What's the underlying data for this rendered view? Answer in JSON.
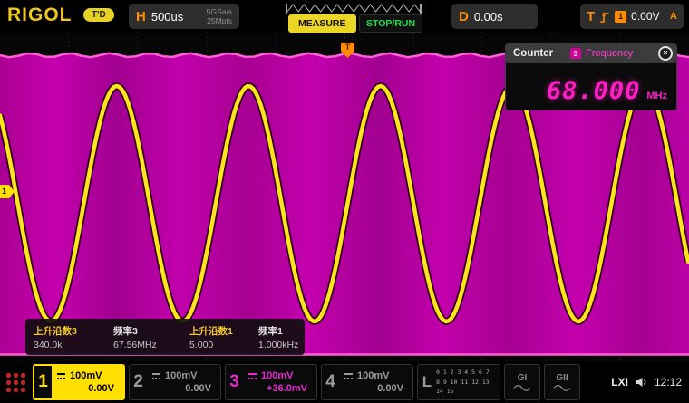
{
  "topbar": {
    "logo": "RIGOL",
    "trig_status": "T'D",
    "horizontal": {
      "label": "H",
      "timebase": "500us",
      "sample_rate": "5GSa/s",
      "memory_depth": "25Mpts"
    },
    "measure_button": "MEASURE",
    "run_button": "STOP/RUN",
    "delay": {
      "label": "D",
      "value": "0.00s"
    },
    "trigger": {
      "label": "T",
      "source": "1",
      "level": "0.00V",
      "mode": "A"
    }
  },
  "markers": {
    "trigger": "T",
    "channel1": "1"
  },
  "counter": {
    "title": "Counter",
    "source": "3",
    "mode": "Frequency",
    "value": "68.000",
    "unit": "MHz",
    "close": "✕"
  },
  "measurements": {
    "items": [
      {
        "label": "上升沿数3",
        "value": "340.0k"
      },
      {
        "label": "频率3",
        "value": "67.56MHz"
      },
      {
        "label": "上升沿数1",
        "value": "5.000"
      },
      {
        "label": "频率1",
        "value": "1.000kHz"
      }
    ]
  },
  "channels": [
    {
      "num": "1",
      "scale": "100mV",
      "offset": "0.00V",
      "color": "#ffe000"
    },
    {
      "num": "2",
      "scale": "100mV",
      "offset": "0.00V",
      "color": "#9a9a9a"
    },
    {
      "num": "3",
      "scale": "100mV",
      "offset": "+36.0mV",
      "color": "#e62ad0"
    },
    {
      "num": "4",
      "scale": "100mV",
      "offset": "0.00V",
      "color": "#9a9a9a"
    }
  ],
  "digital": {
    "label": "L",
    "row1": "0 1 2 3 4 5 6 7",
    "row2": "8 9 10 11 12 13 14 15"
  },
  "groups": {
    "g1": "GI",
    "g2": "GII"
  },
  "status": {
    "lxi": "LXI",
    "time": "12:12"
  },
  "colors": {
    "channel1_yellow": "#ffe000",
    "channel3_magenta": "#cc00aa",
    "trigger_orange": "#ff8a00",
    "run_green": "#23dd4e",
    "counter_readout": "#ff1dc6"
  }
}
